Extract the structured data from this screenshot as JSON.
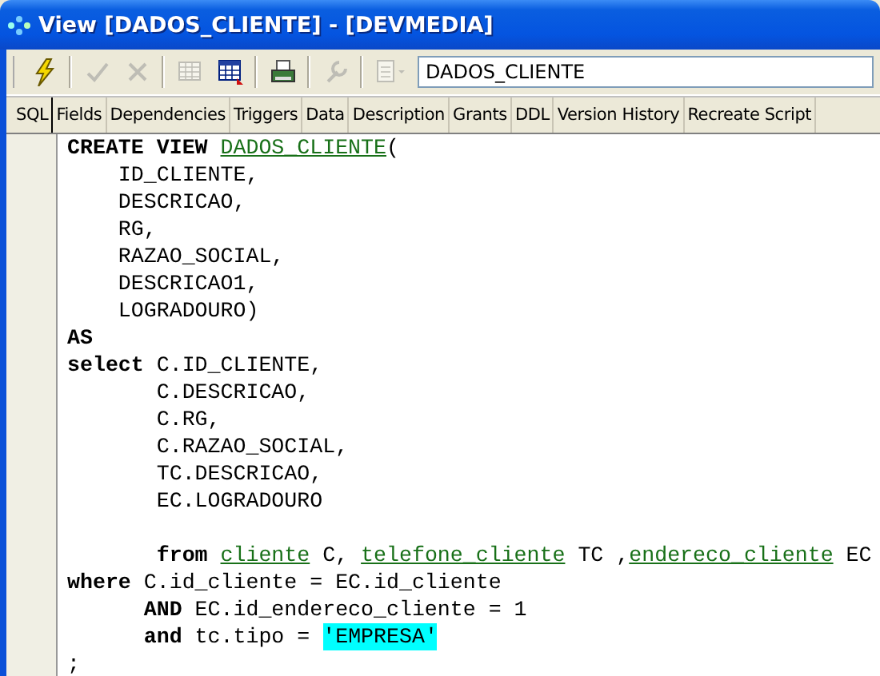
{
  "window": {
    "title": "View [DADOS_CLIENTE] - [DEVMEDIA]"
  },
  "toolbar": {
    "buttons": [
      {
        "kind": "lightning",
        "disabled": false
      },
      {
        "kind": "check",
        "disabled": true
      },
      {
        "kind": "cross",
        "disabled": true
      },
      {
        "kind": "grid",
        "disabled": true
      },
      {
        "kind": "grid-export",
        "disabled": false
      },
      {
        "kind": "printer",
        "disabled": false
      },
      {
        "kind": "wrench",
        "disabled": true
      },
      {
        "kind": "document-dropdown",
        "disabled": true
      }
    ],
    "object_name": "DADOS_CLIENTE"
  },
  "tabs": [
    {
      "label": "SQL",
      "selected": true
    },
    {
      "label": "Fields",
      "selected": false
    },
    {
      "label": "Dependencies",
      "selected": false
    },
    {
      "label": "Triggers",
      "selected": false
    },
    {
      "label": "Data",
      "selected": false
    },
    {
      "label": "Description",
      "selected": false
    },
    {
      "label": "Grants",
      "selected": false
    },
    {
      "label": "DDL",
      "selected": false
    },
    {
      "label": "Version History",
      "selected": false
    },
    {
      "label": "Recreate Script",
      "selected": false
    }
  ],
  "editor": {
    "lines": [
      {
        "kind": "code",
        "tokens": [
          {
            "kind": "keyword",
            "text": "CREATE VIEW "
          },
          {
            "kind": "identifier",
            "text": "DADOS_CLIENTE"
          },
          {
            "kind": "plain",
            "text": "("
          }
        ]
      },
      {
        "kind": "code",
        "tokens": [
          {
            "kind": "plain",
            "text": "    ID_CLIENTE,"
          }
        ]
      },
      {
        "kind": "code",
        "tokens": [
          {
            "kind": "plain",
            "text": "    DESCRICAO,"
          }
        ]
      },
      {
        "kind": "code",
        "tokens": [
          {
            "kind": "plain",
            "text": "    RG,"
          }
        ]
      },
      {
        "kind": "code",
        "tokens": [
          {
            "kind": "plain",
            "text": "    RAZAO_SOCIAL,"
          }
        ]
      },
      {
        "kind": "code",
        "tokens": [
          {
            "kind": "plain",
            "text": "    DESCRICAO1,"
          }
        ]
      },
      {
        "kind": "code",
        "tokens": [
          {
            "kind": "plain",
            "text": "    LOGRADOURO)"
          }
        ]
      },
      {
        "kind": "code",
        "tokens": [
          {
            "kind": "keyword",
            "text": "AS"
          }
        ]
      },
      {
        "kind": "code",
        "tokens": [
          {
            "kind": "keyword",
            "text": "select"
          },
          {
            "kind": "plain",
            "text": " C.ID_CLIENTE,"
          }
        ]
      },
      {
        "kind": "code",
        "tokens": [
          {
            "kind": "plain",
            "text": "       C.DESCRICAO,"
          }
        ]
      },
      {
        "kind": "code",
        "tokens": [
          {
            "kind": "plain",
            "text": "       C.RG,"
          }
        ]
      },
      {
        "kind": "code",
        "tokens": [
          {
            "kind": "plain",
            "text": "       C.RAZAO_SOCIAL,"
          }
        ]
      },
      {
        "kind": "code",
        "tokens": [
          {
            "kind": "plain",
            "text": "       TC.DESCRICAO,"
          }
        ]
      },
      {
        "kind": "code",
        "tokens": [
          {
            "kind": "plain",
            "text": "       EC.LOGRADOURO"
          }
        ]
      },
      {
        "kind": "blank"
      },
      {
        "kind": "code",
        "tokens": [
          {
            "kind": "keyword",
            "text": "       from "
          },
          {
            "kind": "identifier",
            "text": "cliente"
          },
          {
            "kind": "plain",
            "text": " C, "
          },
          {
            "kind": "identifier",
            "text": "telefone_cliente"
          },
          {
            "kind": "plain",
            "text": " TC ,"
          },
          {
            "kind": "identifier",
            "text": "endereco_cliente"
          },
          {
            "kind": "plain",
            "text": " EC"
          }
        ]
      },
      {
        "kind": "code",
        "tokens": [
          {
            "kind": "keyword",
            "text": "where"
          },
          {
            "kind": "plain",
            "text": " C.id_cliente = EC.id_cliente"
          }
        ]
      },
      {
        "kind": "code",
        "tokens": [
          {
            "kind": "keyword",
            "text": "      AND"
          },
          {
            "kind": "plain",
            "text": " EC.id_endereco_cliente = 1"
          }
        ]
      },
      {
        "kind": "code",
        "tokens": [
          {
            "kind": "keyword",
            "text": "      and"
          },
          {
            "kind": "plain",
            "text": " tc.tipo = "
          },
          {
            "kind": "string",
            "text": "'EMPRESA'"
          }
        ]
      },
      {
        "kind": "code",
        "tokens": [
          {
            "kind": "plain",
            "text": ";"
          }
        ]
      }
    ]
  }
}
